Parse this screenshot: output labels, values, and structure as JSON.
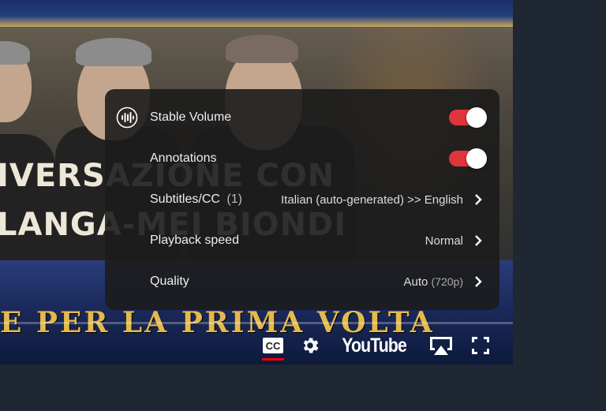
{
  "video": {
    "overlay_line1": "IVERSAZIONE CON",
    "overlay_line2": "LANGA-MEI BIONDI",
    "bottom_title": "E PER LA PRIMA VOLTA",
    "progress_fraction": 0.0
  },
  "settings_menu": {
    "items": [
      {
        "label": "Stable Volume",
        "icon": "stable-volume-icon",
        "toggle": true
      },
      {
        "label": "Annotations",
        "toggle": true
      },
      {
        "label": "Subtitles/CC",
        "sub": "(1)",
        "value": "Italian (auto-generated) >> English"
      },
      {
        "label": "Playback speed",
        "value": "Normal"
      },
      {
        "label": "Quality",
        "value": "Auto",
        "value_sub": "(720p)"
      }
    ]
  },
  "controls": {
    "cc_label": "CC",
    "logo": "YouTube"
  },
  "colors": {
    "accent": "#e0353c",
    "menu_bg": "#1c1c1c",
    "page_bg": "#1e2732"
  }
}
